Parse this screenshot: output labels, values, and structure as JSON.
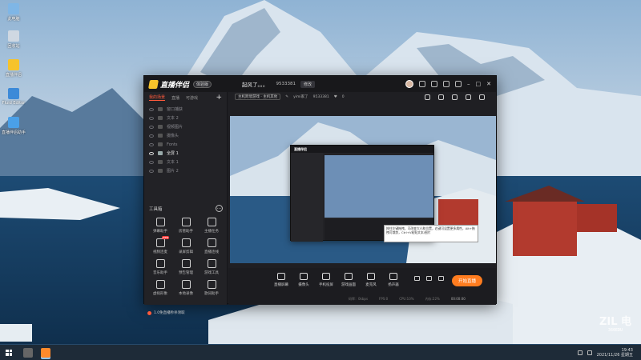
{
  "desktop_icons": [
    {
      "label": "此电脑",
      "icon": "computer-icon",
      "color": "#7fb6e6"
    },
    {
      "label": "回收站",
      "icon": "recycle-bin-icon",
      "color": "#cfd8e2"
    },
    {
      "label": "直播伴侣",
      "icon": "app-shortcut-icon",
      "color": "#f6c32b"
    },
    {
      "label": "Fluid Editor",
      "icon": "app-shortcut-icon",
      "color": "#3c8ad8"
    },
    {
      "label": "直播伴侣助手",
      "icon": "app-shortcut-icon",
      "color": "#4aa0e8"
    }
  ],
  "app": {
    "name": "直播伴侣",
    "version_badge": "体验版",
    "room_title": "起风了。。。",
    "room_id": "9533381",
    "room_button": "修改",
    "category": "主机跨境游戏 · 主机其他",
    "anchor": "yimi家了",
    "anchor_id": "9533381",
    "likes": "0"
  },
  "sidebar": {
    "tabs": [
      "我的场景",
      "直播",
      "可游戏"
    ],
    "active_tab": 0,
    "scenes": [
      {
        "label": "窗口捕获",
        "active": false
      },
      {
        "label": "文本 2",
        "active": false
      },
      {
        "label": "视频图片",
        "active": false
      },
      {
        "label": "摄像头",
        "active": false
      },
      {
        "label": "Fonts",
        "active": false
      },
      {
        "label": "全屏 1",
        "active": true
      },
      {
        "label": "文本 1",
        "active": false
      },
      {
        "label": "图片 2",
        "active": false
      }
    ],
    "tools_title": "工具箱",
    "tools": [
      {
        "label": "弹幕助手",
        "icon": "chat-icon",
        "badge": ""
      },
      {
        "label": "房管助手",
        "icon": "user-icon",
        "badge": ""
      },
      {
        "label": "主播任务",
        "icon": "task-icon",
        "badge": ""
      },
      {
        "label": "视频连麦",
        "icon": "video-link-icon",
        "badge": "new"
      },
      {
        "label": "录屏剪辑",
        "icon": "download-icon",
        "badge": ""
      },
      {
        "label": "直播连线",
        "icon": "link-icon",
        "badge": ""
      },
      {
        "label": "音乐助手",
        "icon": "music-icon",
        "badge": ""
      },
      {
        "label": "预告管理",
        "icon": "calendar-icon",
        "badge": ""
      },
      {
        "label": "游戏工具",
        "icon": "game-icon",
        "badge": ""
      },
      {
        "label": "虚拟形象",
        "icon": "avatar-icon",
        "badge": ""
      },
      {
        "label": "本地录像",
        "icon": "record-icon",
        "badge": ""
      },
      {
        "label": "歌词助手",
        "icon": "lyrics-icon",
        "badge": ""
      }
    ],
    "footer": "1.0免直播秒杀领取"
  },
  "preview": {
    "tooltip": "按住左键拖拽，可改变大小和位置，右键可设置更多属性，Alt+拖拽可裁剪，Ctrl+V粘贴文本/图片"
  },
  "toolbar": {
    "buttons": [
      {
        "label": "直播屏幕",
        "icon": "screen-icon"
      },
      {
        "label": "摄像头",
        "icon": "camera-icon"
      },
      {
        "label": "手机投屏",
        "icon": "phone-cast-icon"
      },
      {
        "label": "游戏画面",
        "icon": "play-icon"
      },
      {
        "label": "麦克风",
        "icon": "mic-icon"
      },
      {
        "label": "扬声器",
        "icon": "speaker-icon"
      }
    ],
    "live_button": "开始直播",
    "status": [
      "码率：0kbps",
      "FPS:0",
      "CPU:10%",
      "内存:22%"
    ],
    "timer": "00:00:00"
  },
  "taskbar": {
    "time": "19:43",
    "date": "2021/11/26 星期五"
  },
  "watermark": {
    "line1": "ZIL 电",
    "line2": "360EDU"
  }
}
